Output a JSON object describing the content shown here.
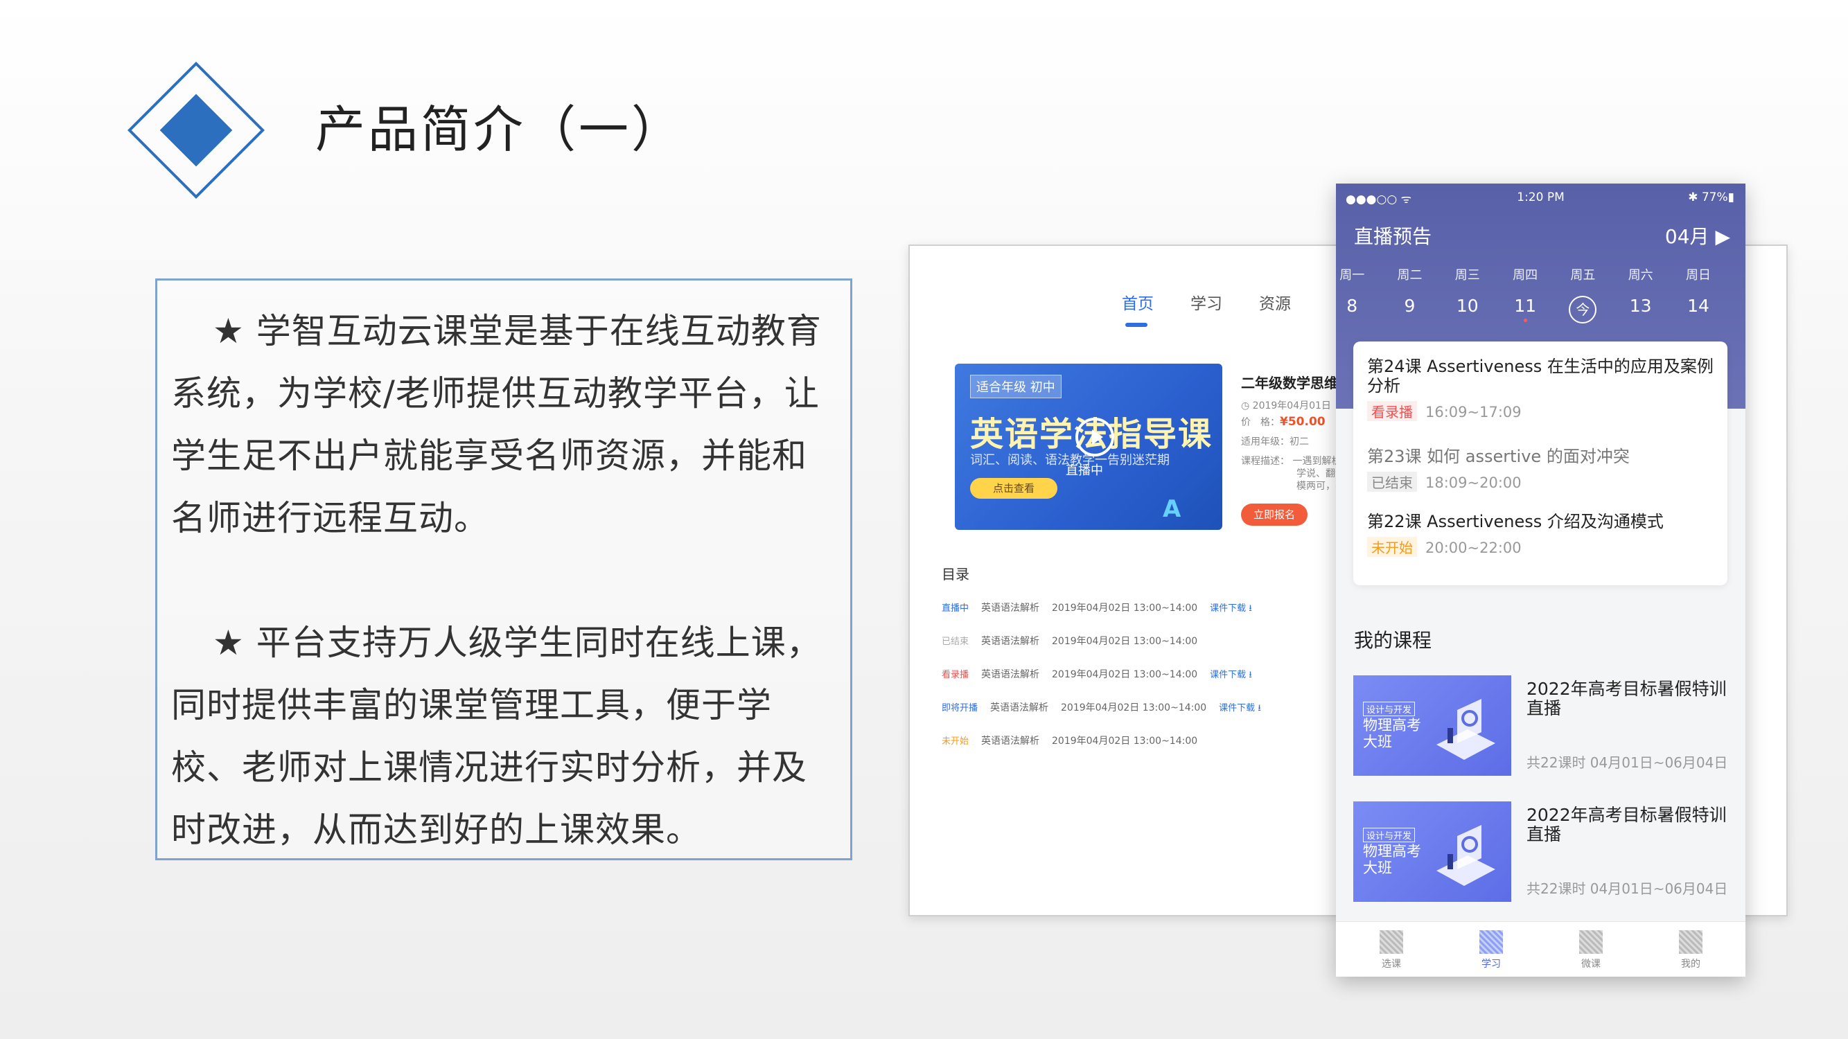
{
  "heading": {
    "title": "产品简介（一）"
  },
  "intro": {
    "paragraphs": [
      "★ 学智互动云课堂是基于在线互动教育系统，为学校/老师提供互动教学平台，让学生足不出户就能享受名师资源，并能和名师进行远程互动。",
      "★ 平台支持万人级学生同时在线上课，同时提供丰富的课堂管理工具，便于学校、老师对上课情况进行实时分析，并及时改进，从而达到好的上课效果。"
    ]
  },
  "desktop": {
    "tabs": [
      "首页",
      "学习",
      "资源"
    ],
    "banner": {
      "tag": "适合年级  初中",
      "title": "英语学法指导课",
      "subtitle": "词汇、阅读、语法教学一告别迷茫期",
      "button": "点击查看",
      "live": "直播中"
    },
    "course": {
      "title": "二年级数学思维",
      "date": "2019年04月01日",
      "price_label": "价　格：",
      "price": "¥50.00",
      "grade": "适用年级：初二",
      "desc_label": "课程描述：",
      "desc_lines": [
        "一遇到解析",
        "学说、翻译",
        "模两可，不"
      ],
      "signup": "立即报名"
    },
    "toc": {
      "label": "目录",
      "rows": [
        {
          "status": "直播中",
          "status_color": "#2f6de1",
          "name": "英语语法解析",
          "time": "2019年04月02日 13:00~14:00",
          "download": "课件下载 ⭳"
        },
        {
          "status": "已结束",
          "status_color": "#aaaaaa",
          "name": "英语语法解析",
          "time": "2019年04月02日 13:00~14:00",
          "download": ""
        },
        {
          "status": "看录播",
          "status_color": "#f05050",
          "name": "英语语法解析",
          "time": "2019年04月02日 13:00~14:00",
          "download": "课件下载 ⭳"
        },
        {
          "status": "即将开播",
          "status_color": "#2f6de1",
          "name": "英语语法解析",
          "time": "2019年04月02日 13:00~14:00",
          "download": "课件下载 ⭳"
        },
        {
          "status": "未开始",
          "status_color": "#f59a1a",
          "name": "英语语法解析",
          "time": "2019年04月02日 13:00~14:00",
          "download": ""
        }
      ]
    }
  },
  "phone": {
    "status": {
      "carrier": "●●●○○ ᯤ",
      "time": "1:20 PM",
      "battery": "✱ 77%▮"
    },
    "live_title": "直播预告",
    "month": "04月 ▶",
    "week": [
      {
        "name": "周一",
        "num": "8"
      },
      {
        "name": "周二",
        "num": "9"
      },
      {
        "name": "周三",
        "num": "10"
      },
      {
        "name": "周四",
        "num": "11",
        "dot": true
      },
      {
        "name": "周五",
        "num": "今",
        "today": true
      },
      {
        "name": "周六",
        "num": "13"
      },
      {
        "name": "周日",
        "num": "14"
      }
    ],
    "schedule": [
      {
        "title": "第24课 Assertiveness 在生活中的应用及案例分析",
        "badge": "看录播",
        "time": "16:09~17:09"
      },
      {
        "title": "第23课 如何 assertive 的面对冲突",
        "badge": "已结束",
        "time": "18:09~20:00"
      },
      {
        "title": "第22课 Assertiveness 介绍及沟通模式",
        "badge": "未开始",
        "time": "20:00~22:00"
      }
    ],
    "my_courses_title": "我的课程",
    "courses": [
      {
        "thumb_tag": "设计与开发",
        "thumb_text": "物理高考大班",
        "title": "2022年高考目标暑假特训直播",
        "meta": "共22课时  04月01日~06月04日"
      },
      {
        "thumb_tag": "设计与开发",
        "thumb_text": "物理高考大班",
        "title": "2022年高考目标暑假特训直播",
        "meta": "共22课时  04月01日~06月04日"
      }
    ],
    "tabs": [
      "选课",
      "学习",
      "微课",
      "我的"
    ]
  }
}
